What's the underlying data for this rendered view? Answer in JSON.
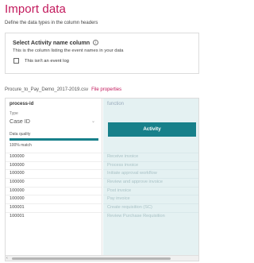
{
  "page": {
    "title": "Import data",
    "subtitle": "Define the data types in the column headers"
  },
  "panel": {
    "title": "Select Activity name column",
    "info_icon": "i",
    "description": "This is the column listing the event names in your data",
    "checkbox_label": "This isn't an event log",
    "checkbox_checked": false
  },
  "file": {
    "name": "Procure_to_Pay_Demo_2017-2019.csv",
    "properties_link": "File properties"
  },
  "columns": [
    {
      "header": "process-id",
      "type_label": "Type",
      "type_value": "Case ID",
      "chevron": "⌄",
      "quality_label": "Data quality",
      "quality_fraction": 1.0,
      "quality_text": "100% match",
      "rows": [
        "100000",
        "100000",
        "100000",
        "100000",
        "100000",
        "100000",
        "100001",
        "100001"
      ]
    },
    {
      "header": "function",
      "button_label": "Activity",
      "rows": [
        "Receive invoice",
        "Process invoice",
        "Initiate approval workflow",
        "Review and approve invoice",
        "Post invoice",
        "Pay invoice",
        "Create requisition (SC)",
        "Review Purchase Requisition"
      ]
    }
  ],
  "scrollbar": {
    "left_arrow": "‹"
  },
  "colors": {
    "accent": "#c2185b",
    "teal": "#17808a",
    "column_highlight": "#e4f1f2"
  }
}
